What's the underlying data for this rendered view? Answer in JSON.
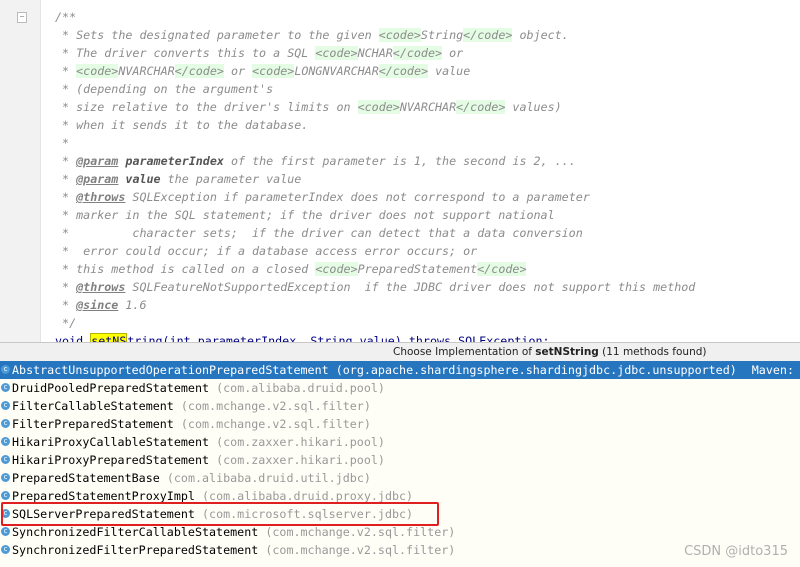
{
  "editor": {
    "comment_lines": [
      [
        [
          "t",
          "/**"
        ]
      ],
      [
        [
          "t",
          " * Sets the designated parameter to the given "
        ],
        [
          "c",
          "<code>"
        ],
        [
          "t",
          "String"
        ],
        [
          "c",
          "</code>"
        ],
        [
          "t",
          " object."
        ]
      ],
      [
        [
          "t",
          " * The driver converts this to a SQL "
        ],
        [
          "c",
          "<code>"
        ],
        [
          "t",
          "NCHAR"
        ],
        [
          "c",
          "</code>"
        ],
        [
          "t",
          " or"
        ]
      ],
      [
        [
          "t",
          " * "
        ],
        [
          "c",
          "<code>"
        ],
        [
          "t",
          "NVARCHAR"
        ],
        [
          "c",
          "</code>"
        ],
        [
          "t",
          " or "
        ],
        [
          "c",
          "<code>"
        ],
        [
          "t",
          "LONGNVARCHAR"
        ],
        [
          "c",
          "</code>"
        ],
        [
          "t",
          " value"
        ]
      ],
      [
        [
          "t",
          " * (depending on the argument's"
        ]
      ],
      [
        [
          "t",
          " * size relative to the driver's limits on "
        ],
        [
          "c",
          "<code>"
        ],
        [
          "t",
          "NVARCHAR"
        ],
        [
          "c",
          "</code>"
        ],
        [
          "t",
          " values)"
        ]
      ],
      [
        [
          "t",
          " * when it sends it to the database."
        ]
      ],
      [
        [
          "t",
          " *"
        ]
      ],
      [
        [
          "t",
          " * "
        ],
        [
          "k",
          "@param"
        ],
        [
          "t",
          " "
        ],
        [
          "b",
          "parameterIndex"
        ],
        [
          "t",
          " of the first parameter is 1, the second is 2, ..."
        ]
      ],
      [
        [
          "t",
          " * "
        ],
        [
          "k",
          "@param"
        ],
        [
          "t",
          " "
        ],
        [
          "b",
          "value"
        ],
        [
          "t",
          " the parameter value"
        ]
      ],
      [
        [
          "t",
          " * "
        ],
        [
          "k",
          "@throws"
        ],
        [
          "t",
          " SQLException if parameterIndex does not correspond to a parameter"
        ]
      ],
      [
        [
          "t",
          " * marker in the SQL statement; if the driver does not support national"
        ]
      ],
      [
        [
          "t",
          " *         character sets;  if the driver can detect that a data conversion"
        ]
      ],
      [
        [
          "t",
          " *  error could occur; if a database access error occurs; or"
        ]
      ],
      [
        [
          "t",
          " * this method is called on a closed "
        ],
        [
          "c",
          "<code>"
        ],
        [
          "t",
          "PreparedStatement"
        ],
        [
          "c",
          "</code>"
        ]
      ],
      [
        [
          "t",
          " * "
        ],
        [
          "k",
          "@throws"
        ],
        [
          "t",
          " SQLFeatureNotSupportedException  if the JDBC driver does not support this method"
        ]
      ],
      [
        [
          "t",
          " * "
        ],
        [
          "k",
          "@since"
        ],
        [
          "t",
          " 1.6"
        ]
      ],
      [
        [
          "t",
          " */"
        ]
      ]
    ],
    "code_line": {
      "prefix": "void ",
      "highlight": "setNS",
      "rest": "tring(int parameterIndex, String value) throws SQLException;"
    }
  },
  "popup": {
    "title_prefix": "Choose Implementation of ",
    "method": "setNString",
    "title_suffix": " (11 methods found)",
    "items": [
      {
        "name": "AbstractUnsupportedOperationPreparedStatement",
        "pkg": "(org.apache.shardingsphere.shardingjdbc.jdbc.unsupported)",
        "extra": "Maven:",
        "selected": true
      },
      {
        "name": "DruidPooledPreparedStatement",
        "pkg": "(com.alibaba.druid.pool)"
      },
      {
        "name": "FilterCallableStatement",
        "pkg": "(com.mchange.v2.sql.filter)"
      },
      {
        "name": "FilterPreparedStatement",
        "pkg": "(com.mchange.v2.sql.filter)"
      },
      {
        "name": "HikariProxyCallableStatement",
        "pkg": "(com.zaxxer.hikari.pool)"
      },
      {
        "name": "HikariProxyPreparedStatement",
        "pkg": "(com.zaxxer.hikari.pool)"
      },
      {
        "name": "PreparedStatementBase",
        "pkg": "(com.alibaba.druid.util.jdbc)"
      },
      {
        "name": "PreparedStatementProxyImpl",
        "pkg": "(com.alibaba.druid.proxy.jdbc)"
      },
      {
        "name": "SQLServerPreparedStatement",
        "pkg": "(com.microsoft.sqlserver.jdbc)",
        "highlighted_box": true
      },
      {
        "name": "SynchronizedFilterCallableStatement",
        "pkg": "(com.mchange.v2.sql.filter)"
      },
      {
        "name": "SynchronizedFilterPreparedStatement",
        "pkg": "(com.mchange.v2.sql.filter)"
      }
    ],
    "class_icon": "class-icon",
    "class_icon_glyph": "c"
  },
  "watermark": "CSDN @idto315",
  "colors": {
    "selection": "#2675bf",
    "code_tag_bg": "#e3fce3",
    "highlight": "#ffff00",
    "annotation_box": "#e02020"
  }
}
